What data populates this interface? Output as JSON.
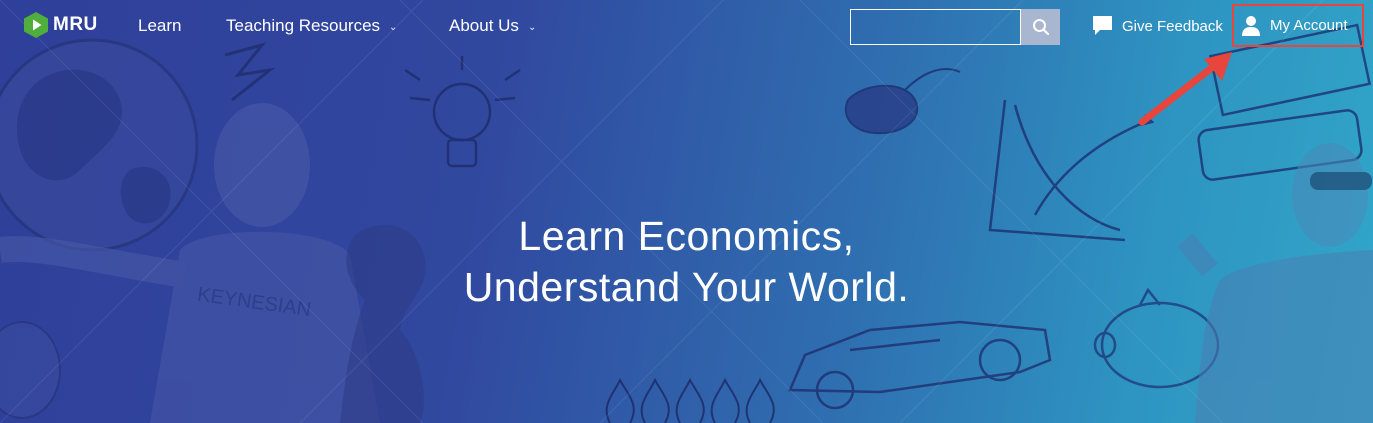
{
  "brand": {
    "logo_text": "MRU",
    "accent": "#4fae3c"
  },
  "nav": {
    "learn": "Learn",
    "teaching_resources": "Teaching Resources",
    "about_us": "About Us",
    "chevron": "⌄"
  },
  "search": {
    "placeholder": "",
    "value": ""
  },
  "header_right": {
    "give_feedback": "Give Feedback",
    "my_account": "My Account",
    "highlight_color": "#e8453c"
  },
  "hero": {
    "headline_line1": "Learn Economics,",
    "headline_line2": "Understand Your World.",
    "doodle_shirt_text": "KEYNESIAN"
  },
  "icons": {
    "search": "search-icon",
    "feedback": "speech-bubble-icon",
    "account": "user-icon",
    "logo": "play-hexagon-icon"
  }
}
